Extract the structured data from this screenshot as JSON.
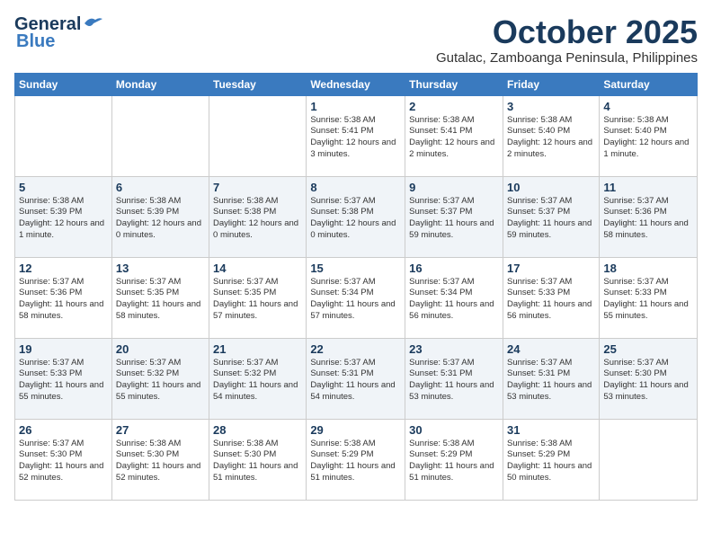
{
  "header": {
    "logo_line1": "General",
    "logo_line2": "Blue",
    "month": "October 2025",
    "location": "Gutalac, Zamboanga Peninsula, Philippines"
  },
  "days_of_week": [
    "Sunday",
    "Monday",
    "Tuesday",
    "Wednesday",
    "Thursday",
    "Friday",
    "Saturday"
  ],
  "weeks": [
    [
      {
        "day": "",
        "detail": ""
      },
      {
        "day": "",
        "detail": ""
      },
      {
        "day": "",
        "detail": ""
      },
      {
        "day": "1",
        "detail": "Sunrise: 5:38 AM\nSunset: 5:41 PM\nDaylight: 12 hours\nand 3 minutes."
      },
      {
        "day": "2",
        "detail": "Sunrise: 5:38 AM\nSunset: 5:41 PM\nDaylight: 12 hours\nand 2 minutes."
      },
      {
        "day": "3",
        "detail": "Sunrise: 5:38 AM\nSunset: 5:40 PM\nDaylight: 12 hours\nand 2 minutes."
      },
      {
        "day": "4",
        "detail": "Sunrise: 5:38 AM\nSunset: 5:40 PM\nDaylight: 12 hours\nand 1 minute."
      }
    ],
    [
      {
        "day": "5",
        "detail": "Sunrise: 5:38 AM\nSunset: 5:39 PM\nDaylight: 12 hours\nand 1 minute."
      },
      {
        "day": "6",
        "detail": "Sunrise: 5:38 AM\nSunset: 5:39 PM\nDaylight: 12 hours\nand 0 minutes."
      },
      {
        "day": "7",
        "detail": "Sunrise: 5:38 AM\nSunset: 5:38 PM\nDaylight: 12 hours\nand 0 minutes."
      },
      {
        "day": "8",
        "detail": "Sunrise: 5:37 AM\nSunset: 5:38 PM\nDaylight: 12 hours\nand 0 minutes."
      },
      {
        "day": "9",
        "detail": "Sunrise: 5:37 AM\nSunset: 5:37 PM\nDaylight: 11 hours\nand 59 minutes."
      },
      {
        "day": "10",
        "detail": "Sunrise: 5:37 AM\nSunset: 5:37 PM\nDaylight: 11 hours\nand 59 minutes."
      },
      {
        "day": "11",
        "detail": "Sunrise: 5:37 AM\nSunset: 5:36 PM\nDaylight: 11 hours\nand 58 minutes."
      }
    ],
    [
      {
        "day": "12",
        "detail": "Sunrise: 5:37 AM\nSunset: 5:36 PM\nDaylight: 11 hours\nand 58 minutes."
      },
      {
        "day": "13",
        "detail": "Sunrise: 5:37 AM\nSunset: 5:35 PM\nDaylight: 11 hours\nand 58 minutes."
      },
      {
        "day": "14",
        "detail": "Sunrise: 5:37 AM\nSunset: 5:35 PM\nDaylight: 11 hours\nand 57 minutes."
      },
      {
        "day": "15",
        "detail": "Sunrise: 5:37 AM\nSunset: 5:34 PM\nDaylight: 11 hours\nand 57 minutes."
      },
      {
        "day": "16",
        "detail": "Sunrise: 5:37 AM\nSunset: 5:34 PM\nDaylight: 11 hours\nand 56 minutes."
      },
      {
        "day": "17",
        "detail": "Sunrise: 5:37 AM\nSunset: 5:33 PM\nDaylight: 11 hours\nand 56 minutes."
      },
      {
        "day": "18",
        "detail": "Sunrise: 5:37 AM\nSunset: 5:33 PM\nDaylight: 11 hours\nand 55 minutes."
      }
    ],
    [
      {
        "day": "19",
        "detail": "Sunrise: 5:37 AM\nSunset: 5:33 PM\nDaylight: 11 hours\nand 55 minutes."
      },
      {
        "day": "20",
        "detail": "Sunrise: 5:37 AM\nSunset: 5:32 PM\nDaylight: 11 hours\nand 55 minutes."
      },
      {
        "day": "21",
        "detail": "Sunrise: 5:37 AM\nSunset: 5:32 PM\nDaylight: 11 hours\nand 54 minutes."
      },
      {
        "day": "22",
        "detail": "Sunrise: 5:37 AM\nSunset: 5:31 PM\nDaylight: 11 hours\nand 54 minutes."
      },
      {
        "day": "23",
        "detail": "Sunrise: 5:37 AM\nSunset: 5:31 PM\nDaylight: 11 hours\nand 53 minutes."
      },
      {
        "day": "24",
        "detail": "Sunrise: 5:37 AM\nSunset: 5:31 PM\nDaylight: 11 hours\nand 53 minutes."
      },
      {
        "day": "25",
        "detail": "Sunrise: 5:37 AM\nSunset: 5:30 PM\nDaylight: 11 hours\nand 53 minutes."
      }
    ],
    [
      {
        "day": "26",
        "detail": "Sunrise: 5:37 AM\nSunset: 5:30 PM\nDaylight: 11 hours\nand 52 minutes."
      },
      {
        "day": "27",
        "detail": "Sunrise: 5:38 AM\nSunset: 5:30 PM\nDaylight: 11 hours\nand 52 minutes."
      },
      {
        "day": "28",
        "detail": "Sunrise: 5:38 AM\nSunset: 5:30 PM\nDaylight: 11 hours\nand 51 minutes."
      },
      {
        "day": "29",
        "detail": "Sunrise: 5:38 AM\nSunset: 5:29 PM\nDaylight: 11 hours\nand 51 minutes."
      },
      {
        "day": "30",
        "detail": "Sunrise: 5:38 AM\nSunset: 5:29 PM\nDaylight: 11 hours\nand 51 minutes."
      },
      {
        "day": "31",
        "detail": "Sunrise: 5:38 AM\nSunset: 5:29 PM\nDaylight: 11 hours\nand 50 minutes."
      },
      {
        "day": "",
        "detail": ""
      }
    ]
  ]
}
